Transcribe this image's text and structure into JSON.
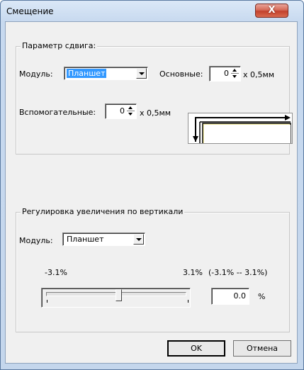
{
  "window": {
    "title": "Смещение",
    "close_glyph": "X"
  },
  "shift_group": {
    "legend": "Параметр сдвига:",
    "module_label": "Модуль:",
    "module_value": "Планшет",
    "main_label": "Основные:",
    "main_value": "0",
    "main_unit": "x 0,5мм",
    "aux_label": "Вспомогательные:",
    "aux_value": "0",
    "aux_unit": "x 0,5мм"
  },
  "vertical_group": {
    "legend": "Регулировка увеличения по вертикали",
    "module_label": "Модуль:",
    "module_value": "Планшет",
    "min_label": "-3.1%",
    "max_label": "3.1%",
    "range_label": "(-3.1% -- 3.1%)",
    "slider_value": 0.0,
    "value_text": "0.0",
    "unit": "%"
  },
  "buttons": {
    "ok": "OK",
    "cancel": "Отмена"
  },
  "colors": {
    "selection": "#3399ff",
    "preview_sheet": "#fff8b0",
    "close_button": "#c2412c"
  }
}
